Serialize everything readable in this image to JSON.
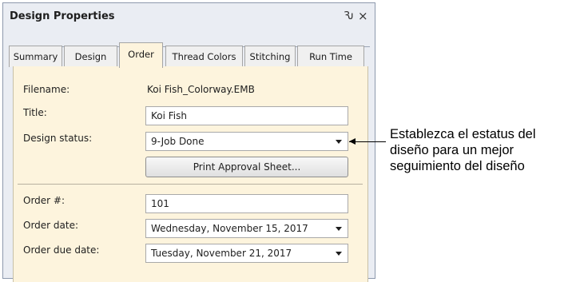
{
  "panel": {
    "title": "Design Properties",
    "pin_glyph": "Ԅ",
    "close_glyph": "×"
  },
  "tabs": [
    {
      "label": "Summary",
      "active": false
    },
    {
      "label": "Design",
      "active": false
    },
    {
      "label": "Order",
      "active": true
    },
    {
      "label": "Thread Colors",
      "active": false
    },
    {
      "label": "Stitching",
      "active": false
    },
    {
      "label": "Run Time",
      "active": false
    }
  ],
  "form": {
    "filename_label": "Filename:",
    "filename_value": "Koi Fish_Colorway.EMB",
    "title_label": "Title:",
    "title_value": "Koi Fish",
    "status_label": "Design status:",
    "status_value": "9-Job Done",
    "print_button": "Print Approval Sheet...",
    "order_no_label": "Order #:",
    "order_no_value": "101",
    "order_date_label": "Order date:",
    "order_date_value": "Wednesday, November 15, 2017",
    "due_date_label": "Order due date:",
    "due_date_value": "Tuesday, November 21, 2017"
  },
  "callout": {
    "lines": [
      "Establezca el estatus del",
      "diseño para un mejor",
      "seguimiento del diseño"
    ]
  },
  "icons": {
    "pin": "pin-icon",
    "close": "close-icon",
    "dropdown": "chevron-down-icon"
  }
}
